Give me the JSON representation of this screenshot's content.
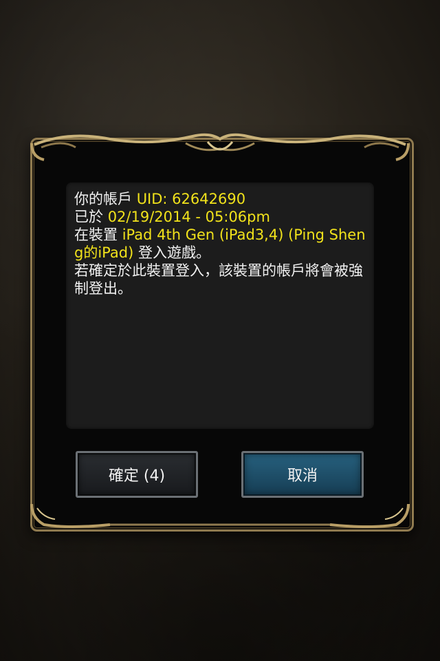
{
  "dialog": {
    "message": {
      "line1_prefix": "你的帳戶 ",
      "uid": "UID: 62642690",
      "line2_prefix": "已於 ",
      "datetime": "02/19/2014 - 05:06pm",
      "line3_prefix": "在裝置 ",
      "device": "iPad 4th Gen (iPad3,4) (Ping Sheng的iPad)",
      "line3_suffix": " 登入遊戲。",
      "warning": "若確定於此裝置登入，該裝置的帳戶將會被強制登出。"
    },
    "buttons": {
      "confirm_label": "確定 (4)",
      "cancel_label": "取消"
    }
  },
  "colors": {
    "highlight": "#f1e21b",
    "frame_gold": "#8f7a4f",
    "cancel_blue": "#27617f"
  }
}
